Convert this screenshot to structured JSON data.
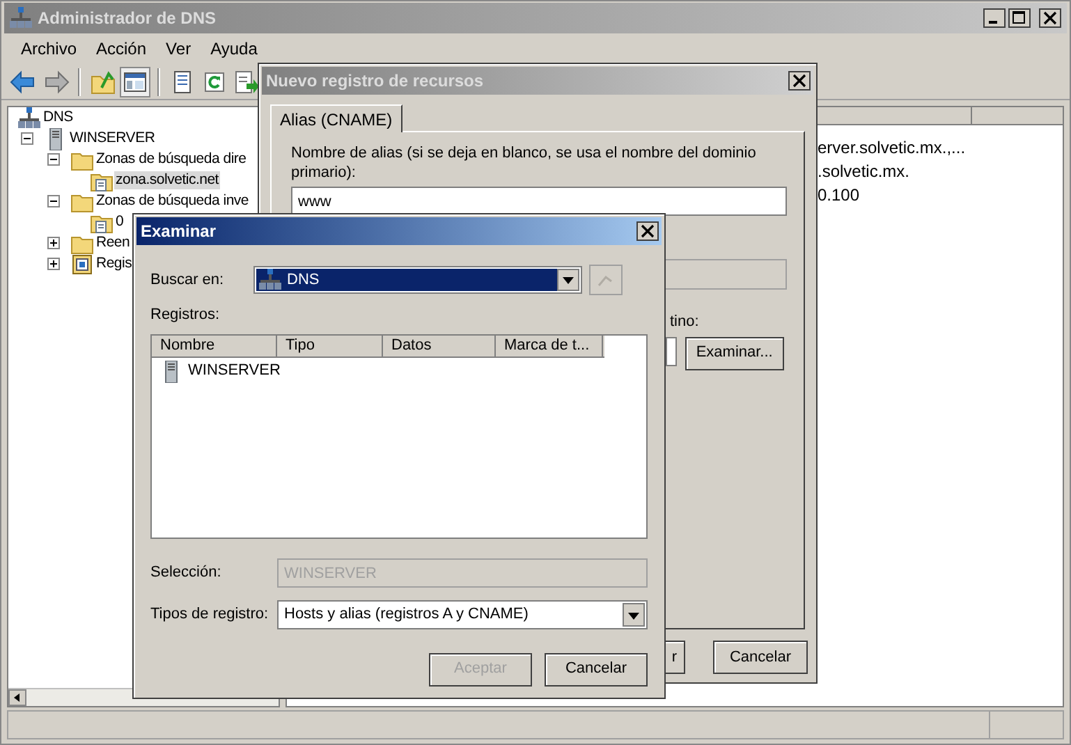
{
  "window": {
    "title": "Administrador de DNS",
    "active": false
  },
  "menu": [
    "Archivo",
    "Acción",
    "Ver",
    "Ayuda"
  ],
  "toolbar": [
    {
      "kind": "back"
    },
    {
      "kind": "forward"
    },
    {
      "kind": "separator"
    },
    {
      "kind": "up"
    },
    {
      "kind": "tree",
      "pressed": true
    },
    {
      "kind": "separator"
    },
    {
      "kind": "properties"
    },
    {
      "kind": "refresh"
    },
    {
      "kind": "export"
    }
  ],
  "tree": [
    {
      "label": "DNS",
      "kind": "dns",
      "selected": false,
      "children": [
        {
          "label": "WINSERVER",
          "kind": "server",
          "selected": false,
          "expanded": true,
          "children": [
            {
              "label": "Zonas de búsqueda dire",
              "kind": "folder",
              "selected": false,
              "expanded": true,
              "children": [
                {
                  "label": "zona.solvetic.net",
                  "kind": "zone",
                  "selected": true
                }
              ]
            },
            {
              "label": "Zonas de búsqueda inve",
              "kind": "folder",
              "selected": false,
              "expanded": true,
              "children": [
                {
                  "label": "0",
                  "kind": "zone",
                  "selected": false
                }
              ]
            },
            {
              "label": "Reen",
              "kind": "folder",
              "selected": false,
              "expanded": false
            },
            {
              "label": "Regis",
              "kind": "records",
              "selected": false,
              "expanded": false
            }
          ]
        }
      ]
    }
  ],
  "list_pane": {
    "rows": [
      "erver.solvetic.mx.,...",
      ".solvetic.mx.",
      "0.100"
    ]
  },
  "new_record_dialog": {
    "title": "Nuevo registro de recursos",
    "active": false,
    "tabs": [
      {
        "label": "Alias (CNAME)",
        "selected": true
      }
    ],
    "alias_label": "Nombre de alias (si se deja en blanco, se usa el nombre del dominio primario):",
    "alias_value": "www",
    "target_label": "tino:",
    "browse_button": "Examinar...",
    "buttons": [
      "r",
      "Cancelar"
    ]
  },
  "browse_dialog": {
    "title": "Examinar",
    "active": true,
    "look_in_label": "Buscar en:",
    "look_in_value": "DNS",
    "up_button": {
      "disabled": true
    },
    "records_label": "Registros:",
    "columns": [
      "Nombre",
      "Tipo",
      "Datos",
      "Marca de t..."
    ],
    "rows": [
      {
        "name": "WINSERVER",
        "kind": "server"
      }
    ],
    "selection_label": "Selección:",
    "selection_value": "WINSERVER",
    "selection_disabled": true,
    "types_label": "Tipos de registro:",
    "types_value": "Hosts y alias (registros A y CNAME)",
    "buttons": [
      {
        "label": "Aceptar",
        "disabled": true
      },
      {
        "label": "Cancelar",
        "disabled": false
      }
    ]
  }
}
